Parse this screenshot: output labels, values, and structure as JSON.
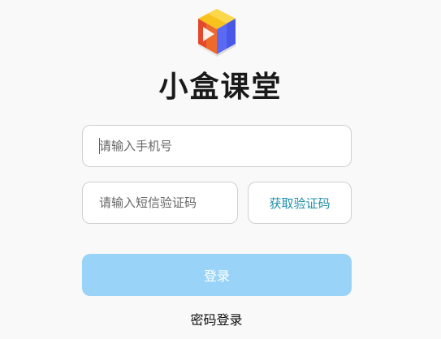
{
  "app": {
    "title": "小盒课堂",
    "logo_icon": "cube-logo-icon"
  },
  "form": {
    "phone_placeholder": "请输入手机号",
    "phone_value": "",
    "code_placeholder": "请输入短信验证码",
    "code_value": "",
    "get_code_label": "获取验证码",
    "login_label": "登录",
    "password_login_label": "密码登录"
  },
  "colors": {
    "background": "#f9f9f9",
    "accent_text": "#1f8fa8",
    "login_button_disabled": "#99d3f7",
    "logo_yellow": "#f8c21c",
    "logo_orange": "#ee6a2a",
    "logo_blue": "#5b6af5",
    "logo_gray": "#e9e9e9"
  }
}
